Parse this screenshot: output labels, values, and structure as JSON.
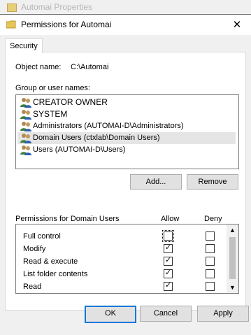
{
  "background_window": {
    "title": "Automai Properties"
  },
  "dialog": {
    "title": "Permissions for Automai",
    "close_symbol": "✕",
    "tab_security": "Security",
    "object_name_label": "Object name:",
    "object_name_value": "C:\\Automai",
    "group_label": "Group or user names:",
    "users": [
      {
        "name": "CREATOR OWNER",
        "icon": "users-group-icon"
      },
      {
        "name": "SYSTEM",
        "icon": "users-group-icon"
      },
      {
        "name": "Administrators (AUTOMAI-D\\Administrators)",
        "icon": "users-group-icon"
      },
      {
        "name": "Domain Users (ctxlab\\Domain Users)",
        "icon": "users-group-icon",
        "selected": true
      },
      {
        "name": "Users (AUTOMAI-D\\Users)",
        "icon": "users-group-icon"
      }
    ],
    "add_button": "Add...",
    "remove_button": "Remove",
    "permissions_label": "Permissions for Domain Users",
    "allow_header": "Allow",
    "deny_header": "Deny",
    "permissions": [
      {
        "name": "Full control",
        "allow": false,
        "deny": false
      },
      {
        "name": "Modify",
        "allow": true,
        "deny": false
      },
      {
        "name": "Read & execute",
        "allow": true,
        "deny": false
      },
      {
        "name": "List folder contents",
        "allow": true,
        "deny": false
      },
      {
        "name": "Read",
        "allow": true,
        "deny": false
      },
      {
        "name": "",
        "allow": true,
        "deny": false
      }
    ],
    "ok_button": "OK",
    "cancel_button": "Cancel",
    "apply_button": "Apply"
  },
  "colors": {
    "focus_border": "#0078d7",
    "selected_row": "#e5e5e5",
    "folder": "#e6c65a"
  }
}
